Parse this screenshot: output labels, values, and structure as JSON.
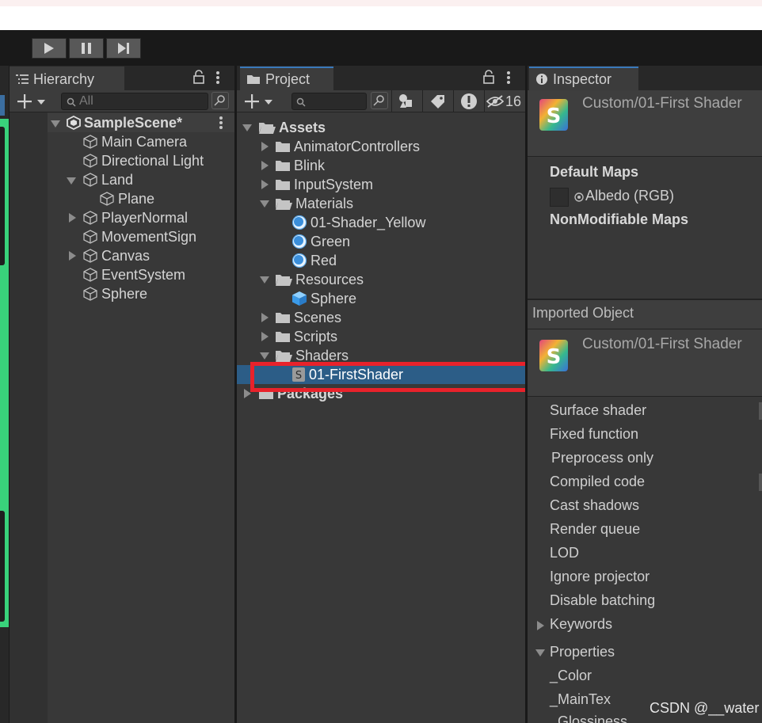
{
  "toolbar": {
    "play": "play-icon",
    "pause": "pause-icon",
    "step": "step-icon"
  },
  "hierarchy": {
    "tab_label": "Hierarchy",
    "search_placeholder": "All",
    "scene": "SampleScene*",
    "items": [
      "Main Camera",
      "Directional Light",
      "Land",
      "Plane",
      "PlayerNormal",
      "MovementSign",
      "Canvas",
      "EventSystem",
      "Sphere"
    ]
  },
  "project": {
    "tab_label": "Project",
    "hidden_count": "16",
    "root": "Assets",
    "items": [
      "AnimatorControllers",
      "Blink",
      "InputSystem",
      "Materials",
      "01-Shader_Yellow",
      "Green",
      "Red",
      "Resources",
      "Sphere",
      "Scenes",
      "Scripts",
      "Shaders",
      "01-FirstShader",
      "Packages"
    ]
  },
  "inspector": {
    "tab_label": "Inspector",
    "asset_title": "Custom/01-First Shader",
    "default_maps": "Default Maps",
    "albedo": "Albedo (RGB)",
    "nonmodifiable": "NonModifiable Maps",
    "imported_object": "Imported Object",
    "imported_title": "Custom/01-First Shader",
    "props": [
      "Surface shader",
      "Fixed function",
      "Preprocess only",
      "Compiled code",
      "Cast shadows",
      "Render queue",
      "LOD",
      "Ignore projector",
      "Disable batching"
    ],
    "keywords": "Keywords",
    "properties": "Properties",
    "property_items": [
      "_Color",
      "_MainTex",
      "_Glossiness"
    ],
    "shader_icon_letter": "S"
  },
  "watermark": "CSDN @__water",
  "colors": {
    "selection": "#2c5d87",
    "highlight_box": "#e8222b",
    "scene_view_green": "#39d27b"
  }
}
